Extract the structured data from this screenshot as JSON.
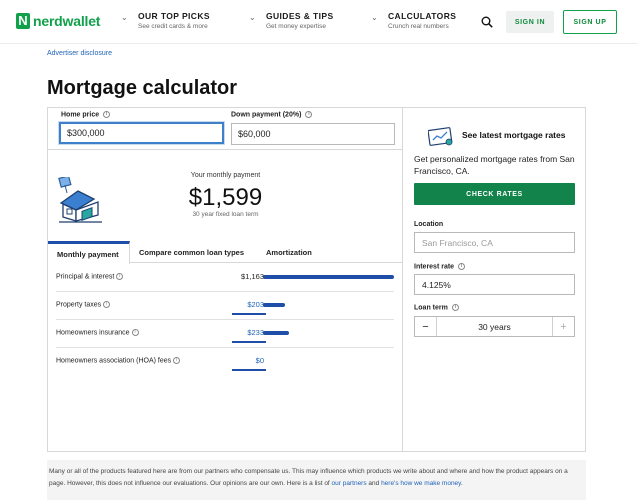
{
  "header": {
    "logo_mark": "N",
    "logo_text": "nerdwallet",
    "nav": [
      {
        "title": "OUR TOP PICKS",
        "sub": "See credit cards & more"
      },
      {
        "title": "GUIDES & TIPS",
        "sub": "Get money expertise"
      },
      {
        "title": "CALCULATORS",
        "sub": "Crunch real numbers"
      }
    ],
    "sign_in": "SIGN IN",
    "sign_up": "SIGN UP"
  },
  "advertiser_disclosure": "Advertiser disclosure",
  "page_title": "Mortgage calculator",
  "calculator": {
    "home_price_label": "Home price",
    "home_price_value": "$300,000",
    "down_payment_label": "Down payment (20%)",
    "down_payment_value": "$60,000",
    "monthly_label": "Your monthly payment",
    "monthly_value": "$1,599",
    "monthly_sub": "30 year fixed loan term",
    "tabs": [
      "Monthly payment",
      "Compare common loan types",
      "Amortization"
    ],
    "rows": [
      {
        "label": "Principal & interest",
        "value": "$1,163",
        "fraction": 1.0
      },
      {
        "label": "Property taxes",
        "value": "$203",
        "fraction": 0.17
      },
      {
        "label": "Homeowners insurance",
        "value": "$233",
        "fraction": 0.2
      },
      {
        "label": "Homeowners association (HOA) fees",
        "value": "$0",
        "fraction": 0
      }
    ]
  },
  "rates": {
    "title": "See latest mortgage rates",
    "desc": "Get personalized mortgage rates from San Francisco, CA.",
    "button": "CHECK RATES",
    "location_label": "Location",
    "location_placeholder": "San Francisco, CA",
    "interest_label": "Interest rate",
    "interest_value": "4.125%",
    "term_label": "Loan term",
    "term_value": "30 years",
    "minus": "−",
    "plus": "+"
  },
  "footer": {
    "text": "Many or all of the products featured here are from our partners who compensate us. This may influence which products we write about and where and how the product appears on a page. However, this does not influence our evaluations. Our opinions are our own. Here is a list of ",
    "link1": "our partners",
    "mid": " and ",
    "link2": "here's how we make money",
    "end": "."
  },
  "colors": {
    "brand_green": "#12a14b",
    "accent_blue": "#1e4ea8",
    "link_blue": "#1f62b8"
  }
}
